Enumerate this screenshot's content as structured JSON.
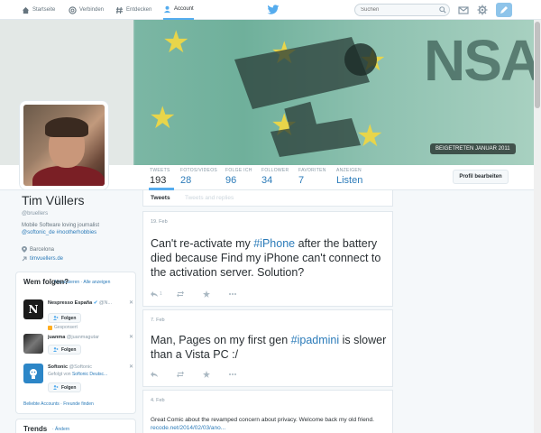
{
  "nav": {
    "home": "Startseite",
    "connect": "Verbinden",
    "discover": "Entdecken",
    "account": "Account",
    "search_placeholder": "Suchen"
  },
  "banner": {
    "big_text": "NSA",
    "joined": "BEIGETRETEN JANUAR 2011"
  },
  "stats": [
    {
      "label": "TWEETS",
      "value": "193"
    },
    {
      "label": "FOTOS/VIDEOS",
      "value": "28"
    },
    {
      "label": "FOLGE ICH",
      "value": "96"
    },
    {
      "label": "FOLLOWER",
      "value": "34"
    },
    {
      "label": "FAVORITEN",
      "value": "7"
    },
    {
      "label": "ANZEIGEN",
      "value": "Listen"
    }
  ],
  "edit_profile": "Profil bearbeiten",
  "profile": {
    "name": "Tim Vüllers",
    "handle": "@bruellers",
    "bio_line1": "Mobile Software loving journalist",
    "bio_line2": "@softonic_de #nootherhobbies",
    "location": "Barcelona",
    "website": "timvuellers.de"
  },
  "who_to_follow": {
    "title": "Wem folgen?",
    "refresh": "· Aktualisieren · Alle anzeigen",
    "follow_label": "Folgen",
    "suggestions": [
      {
        "name": "Nespresso España",
        "handle": "@N...",
        "extra": "Gesponsert"
      },
      {
        "name": "juanma",
        "handle": "@juanmagutar",
        "extra": ""
      },
      {
        "name": "Softonic",
        "handle": "@Softonic",
        "extra_prefix": "Gefolgt von",
        "extra_link": "Softonic Deutsc..."
      }
    ],
    "footer": "Beliebte Accounts · Freunde finden"
  },
  "trends": {
    "title": "Trends",
    "change": "· Ändern"
  },
  "tabs": {
    "tweets": "Tweets",
    "replies": "Tweets and replies"
  },
  "tweets": [
    {
      "date": "19. Feb",
      "pre": "Can't re-activate my ",
      "hashtag": "#iPhone",
      "post": " after the battery died because Find my iPhone can't connect to the activation server. Solution?",
      "retweets": "1"
    },
    {
      "date": "7. Feb",
      "pre": "Man, Pages on my first gen ",
      "hashtag": "#ipadmini",
      "post": " is slower than a Vista PC :/",
      "retweets": ""
    },
    {
      "date": "4. Feb",
      "pre": "Great Comic about the revamped concern about privacy. Welcome back my old friend. ",
      "link": "recode.net/2014/02/03/ano..."
    }
  ],
  "colors": {
    "accent": "#55acee",
    "link": "#2b7bb9",
    "tweet_button": "#8ec4ea"
  }
}
